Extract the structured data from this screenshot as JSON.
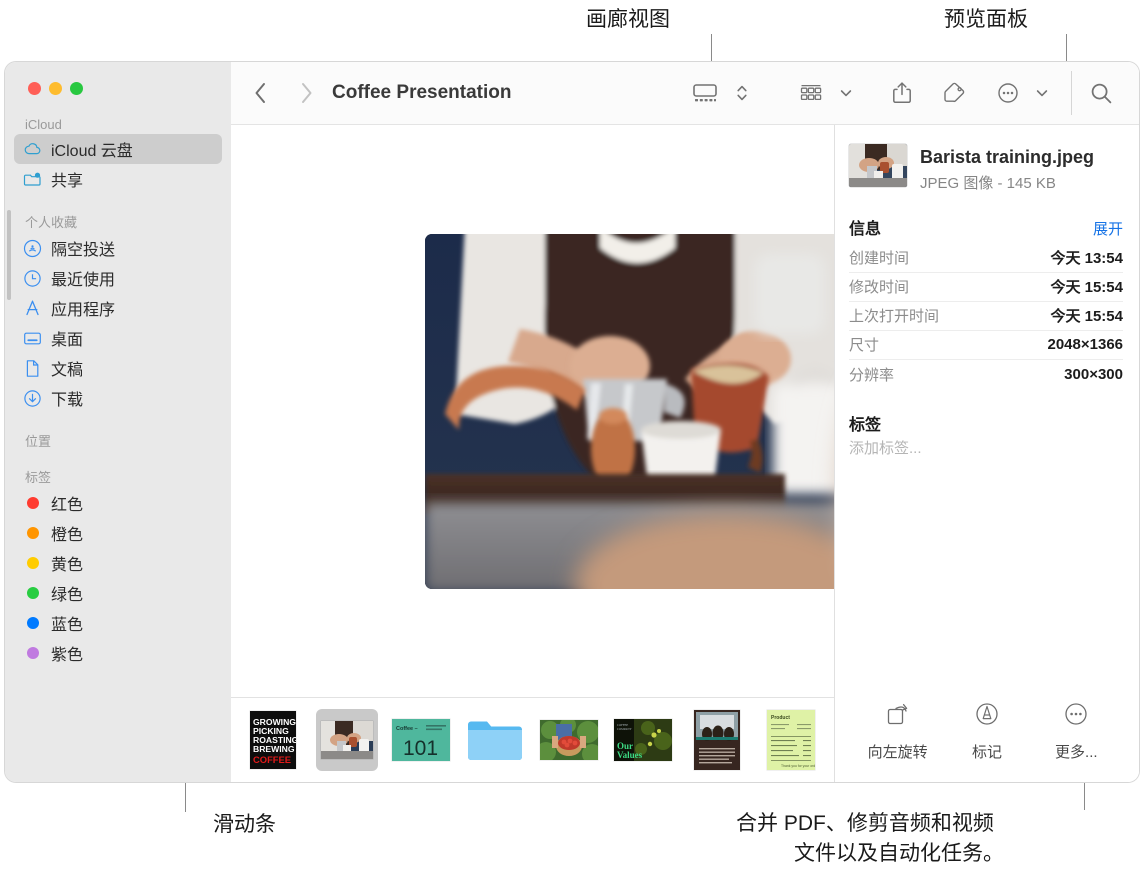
{
  "callouts": [
    {
      "id": "gallery-view",
      "text": "画廊视图"
    },
    {
      "id": "preview-panel",
      "text": "预览面板"
    },
    {
      "id": "scrubber",
      "text": "滑动条"
    },
    {
      "id": "more-actions-line1",
      "text": "合并 PDF、修剪音频和视频"
    },
    {
      "id": "more-actions-line2",
      "text": "文件以及自动化任务。"
    }
  ],
  "toolbar": {
    "title": "Coffee Presentation",
    "back_icon": "chevron-left-icon",
    "forward_icon": "chevron-right-icon",
    "view_mode_icon": "gallery-view-icon",
    "view_stepper_icon": "chevron-up-down-icon",
    "group_icon": "group-by-icon",
    "group_chevron_icon": "chevron-down-icon",
    "share_icon": "share-icon",
    "tag_icon": "tag-icon",
    "more_icon": "ellipsis-circle-icon",
    "more_chevron_icon": "chevron-down-icon",
    "search_icon": "search-icon"
  },
  "sidebar": {
    "sections": [
      {
        "title": "iCloud",
        "items": [
          {
            "label": "iCloud 云盘",
            "icon": "cloud-icon",
            "selected": true
          },
          {
            "label": "共享",
            "icon": "shared-folder-icon",
            "selected": false
          }
        ]
      },
      {
        "title": "个人收藏",
        "items": [
          {
            "label": "隔空投送",
            "icon": "airdrop-icon",
            "selected": false
          },
          {
            "label": "最近使用",
            "icon": "clock-icon",
            "selected": false
          },
          {
            "label": "应用程序",
            "icon": "applications-icon",
            "selected": false
          },
          {
            "label": "桌面",
            "icon": "desktop-icon",
            "selected": false
          },
          {
            "label": "文稿",
            "icon": "document-icon",
            "selected": false
          },
          {
            "label": "下载",
            "icon": "download-icon",
            "selected": false
          }
        ]
      },
      {
        "title": "位置",
        "items": []
      },
      {
        "title": "标签",
        "items": [
          {
            "label": "红色",
            "icon": "tag-dot-icon",
            "color": "#ff3b30"
          },
          {
            "label": "橙色",
            "icon": "tag-dot-icon",
            "color": "#ff9500"
          },
          {
            "label": "黄色",
            "icon": "tag-dot-icon",
            "color": "#ffcc00"
          },
          {
            "label": "绿色",
            "icon": "tag-dot-icon",
            "color": "#28cd41"
          },
          {
            "label": "蓝色",
            "icon": "tag-dot-icon",
            "color": "#007aff"
          },
          {
            "label": "紫色",
            "icon": "tag-dot-icon",
            "color": "#c07ae0"
          }
        ]
      }
    ]
  },
  "gallery": {
    "hero_alt": "barista-pouring-milk-photo",
    "thumbnails": [
      {
        "name": "coffee-poster-thumbnail",
        "selected": false
      },
      {
        "name": "barista-training-thumbnail",
        "selected": true
      },
      {
        "name": "coffee-101-slide-thumbnail",
        "selected": false
      },
      {
        "name": "folder-thumbnail",
        "selected": false
      },
      {
        "name": "cherry-harvest-thumbnail",
        "selected": false
      },
      {
        "name": "our-values-slide-thumbnail",
        "selected": false
      },
      {
        "name": "meeting-document-thumbnail",
        "selected": false
      },
      {
        "name": "green-invoice-thumbnail",
        "selected": false
      }
    ]
  },
  "preview": {
    "file_name": "Barista training.jpeg",
    "file_meta": "JPEG 图像 - 145 KB",
    "info_title": "信息",
    "expand_label": "展开",
    "info_rows": [
      {
        "key": "创建时间",
        "value": "今天 13:54"
      },
      {
        "key": "修改时间",
        "value": "今天 15:54"
      },
      {
        "key": "上次打开时间",
        "value": "今天 15:54"
      },
      {
        "key": "尺寸",
        "value": "2048×1366"
      },
      {
        "key": "分辨率",
        "value": "300×300"
      }
    ],
    "tags_title": "标签",
    "tags_placeholder": "添加标签...",
    "actions": [
      {
        "label": "向左旋转",
        "icon": "rotate-left-icon"
      },
      {
        "label": "标记",
        "icon": "markup-icon"
      },
      {
        "label": "更多...",
        "icon": "ellipsis-circle-icon"
      }
    ]
  },
  "colors": {
    "accent": "#1673e6",
    "sidebar_bg": "#e9e9e9",
    "selection": "#cdcdcd"
  }
}
